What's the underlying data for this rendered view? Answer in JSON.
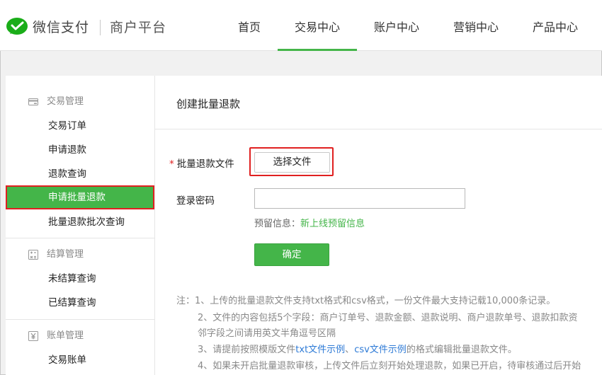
{
  "header": {
    "brand": "微信支付",
    "brand_sub": "商户平台",
    "nav": [
      {
        "label": "首页"
      },
      {
        "label": "交易中心",
        "active": true
      },
      {
        "label": "账户中心"
      },
      {
        "label": "营销中心"
      },
      {
        "label": "产品中心"
      }
    ]
  },
  "sidebar": {
    "groups": [
      {
        "title": "交易管理",
        "icon": "card-icon",
        "items": [
          "交易订单",
          "申请退款",
          "退款查询",
          "申请批量退款",
          "批量退款批次查询"
        ],
        "active_item": "申请批量退款"
      },
      {
        "title": "结算管理",
        "icon": "calculator-icon",
        "items": [
          "未结算查询",
          "已结算查询"
        ]
      },
      {
        "title": "账单管理",
        "icon": "yen-icon",
        "items": [
          "交易账单"
        ]
      }
    ]
  },
  "main": {
    "title": "创建批量退款",
    "form": {
      "file_label": "批量退款文件",
      "required_mark": "*",
      "file_button": "选择文件",
      "password_label": "登录密码",
      "password_value": "",
      "reserve_prefix": "预留信息：",
      "reserve_link": "新上线预留信息",
      "submit": "确定"
    },
    "notes": {
      "line1": "注：1、上传的批量退款文件支持txt格式和csv格式，一份文件最大支持记载10,000条记录。",
      "line2": "2、文件的内容包括5个字段：商户订单号、退款金额、退款说明、商户退款单号、退款扣款资",
      "line2b": "邻字段之间请用英文半角逗号区隔",
      "line3_pre": "3、请提前按照模版文件",
      "line3_link1": "txt文件示例",
      "line3_sep": "、",
      "line3_link2": "csv文件示例",
      "line3_post": "的格式编辑批量退款文件。",
      "line4": "4、如果未开启批量退款审核，上传文件后立刻开始处理退款，如果已开启，待审核通过后开始"
    }
  },
  "colors": {
    "accent": "#44b549",
    "highlight": "#e02020",
    "link": "#2d7ad6"
  }
}
